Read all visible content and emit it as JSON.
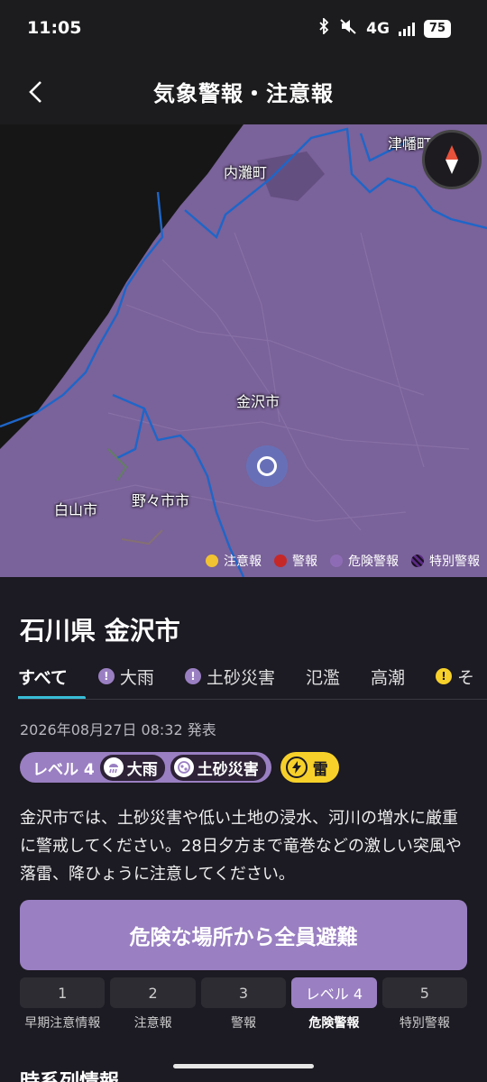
{
  "status": {
    "time": "11:05",
    "network": "4G",
    "battery": "75"
  },
  "header": {
    "title": "気象警報・注意報"
  },
  "map": {
    "labels": {
      "tsubata": "津幡町",
      "uchinada": "内灘町",
      "kanazawa": "金沢市",
      "hakusan": "白山市",
      "nonoichi": "野々市市"
    },
    "legend": [
      {
        "label": "注意報",
        "color": "#f1c232"
      },
      {
        "label": "警報",
        "color": "#c62828"
      },
      {
        "label": "危険警報",
        "color": "#8e6cb5"
      },
      {
        "label": "特別警報",
        "color": "#5b2a86"
      }
    ]
  },
  "place": {
    "title": "石川県 金沢市"
  },
  "tabs": [
    {
      "label": "すべて"
    },
    {
      "label": "大雨",
      "badge": "!"
    },
    {
      "label": "土砂災害",
      "badge": "!"
    },
    {
      "label": "氾濫"
    },
    {
      "label": "高潮"
    },
    {
      "label": "そ",
      "badge": "!"
    }
  ],
  "issued": "2026年08月27日 08:32 発表",
  "chips": {
    "level": "レベル 4",
    "heavy_rain": "大雨",
    "landslide": "土砂災害",
    "thunder": "雷"
  },
  "message": "金沢市では、土砂災害や低い土地の浸水、河川の増水に厳重に警戒してください。28日夕方まで竜巻などの激しい突風や落雷、降ひょうに注意してください。",
  "evacuation_button": "危険な場所から全員避難",
  "levels": [
    {
      "number": "1",
      "name": "早期注意情報"
    },
    {
      "number": "2",
      "name": "注意報"
    },
    {
      "number": "3",
      "name": "警報"
    },
    {
      "number": "レベル 4",
      "name": "危険警報"
    },
    {
      "number": "5",
      "name": "特別警報"
    }
  ],
  "next_section": {
    "title": "時系列情報"
  }
}
